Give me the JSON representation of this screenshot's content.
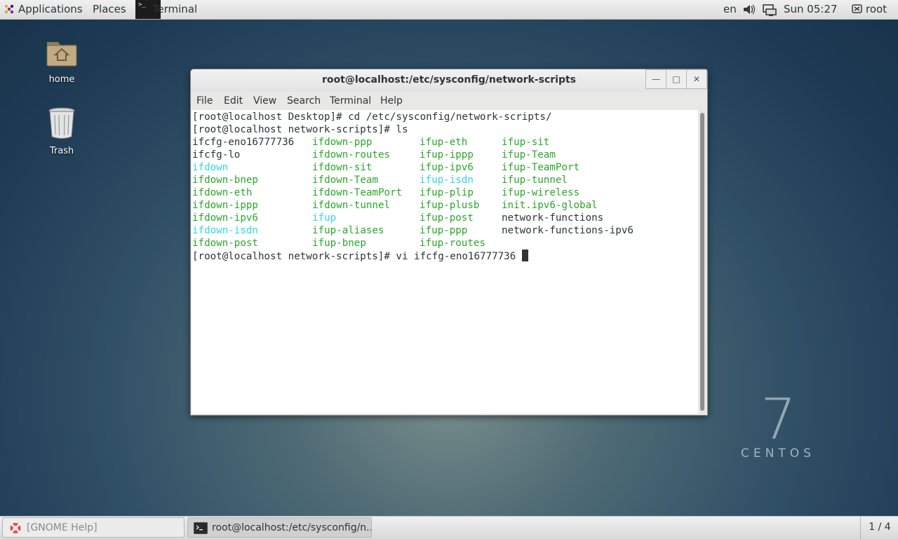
{
  "top_panel": {
    "applications": "Applications",
    "places": "Places",
    "active_app": "Terminal",
    "language": "en",
    "clock": "Sun 05:27",
    "user": "root"
  },
  "desktop": {
    "icons": [
      {
        "label": "home"
      },
      {
        "label": "Trash"
      }
    ],
    "logo_number": "7",
    "logo_word": "CENTOS"
  },
  "terminal": {
    "title": "root@localhost:/etc/sysconfig/network-scripts",
    "menu": [
      "File",
      "Edit",
      "View",
      "Search",
      "Terminal",
      "Help"
    ],
    "line1": "[root@localhost Desktop]# cd /etc/sysconfig/network-scripts/",
    "line2": "[root@localhost network-scripts]# ls",
    "ls_columns": [
      [
        {
          "name": "ifcfg-eno16777736",
          "color": "plain"
        },
        {
          "name": "ifcfg-lo",
          "color": "plain"
        },
        {
          "name": "ifdown",
          "color": "cyan"
        },
        {
          "name": "ifdown-bnep",
          "color": "green"
        },
        {
          "name": "ifdown-eth",
          "color": "green"
        },
        {
          "name": "ifdown-ippp",
          "color": "green"
        },
        {
          "name": "ifdown-ipv6",
          "color": "green"
        },
        {
          "name": "ifdown-isdn",
          "color": "cyan"
        },
        {
          "name": "ifdown-post",
          "color": "green"
        }
      ],
      [
        {
          "name": "ifdown-ppp",
          "color": "green"
        },
        {
          "name": "ifdown-routes",
          "color": "green"
        },
        {
          "name": "ifdown-sit",
          "color": "green"
        },
        {
          "name": "ifdown-Team",
          "color": "green"
        },
        {
          "name": "ifdown-TeamPort",
          "color": "green"
        },
        {
          "name": "ifdown-tunnel",
          "color": "green"
        },
        {
          "name": "ifup",
          "color": "cyan"
        },
        {
          "name": "ifup-aliases",
          "color": "green"
        },
        {
          "name": "ifup-bnep",
          "color": "green"
        }
      ],
      [
        {
          "name": "ifup-eth",
          "color": "green"
        },
        {
          "name": "ifup-ippp",
          "color": "green"
        },
        {
          "name": "ifup-ipv6",
          "color": "green"
        },
        {
          "name": "ifup-isdn",
          "color": "cyan"
        },
        {
          "name": "ifup-plip",
          "color": "green"
        },
        {
          "name": "ifup-plusb",
          "color": "green"
        },
        {
          "name": "ifup-post",
          "color": "green"
        },
        {
          "name": "ifup-ppp",
          "color": "green"
        },
        {
          "name": "ifup-routes",
          "color": "green"
        }
      ],
      [
        {
          "name": "ifup-sit",
          "color": "green"
        },
        {
          "name": "ifup-Team",
          "color": "green"
        },
        {
          "name": "ifup-TeamPort",
          "color": "green"
        },
        {
          "name": "ifup-tunnel",
          "color": "green"
        },
        {
          "name": "ifup-wireless",
          "color": "green"
        },
        {
          "name": "init.ipv6-global",
          "color": "green"
        },
        {
          "name": "network-functions",
          "color": "plain"
        },
        {
          "name": "network-functions-ipv6",
          "color": "plain"
        }
      ]
    ],
    "last_line": "[root@localhost network-scripts]# vi ifcfg-eno16777736 "
  },
  "bottom_panel": {
    "tasks": [
      {
        "label": "[GNOME Help]"
      },
      {
        "label": "root@localhost:/etc/sysconfig/n..."
      }
    ],
    "workspace": "1 / 4"
  },
  "colors": {
    "green": "#2aa72a",
    "cyan": "#32d6e8",
    "text": "#2e3436"
  }
}
